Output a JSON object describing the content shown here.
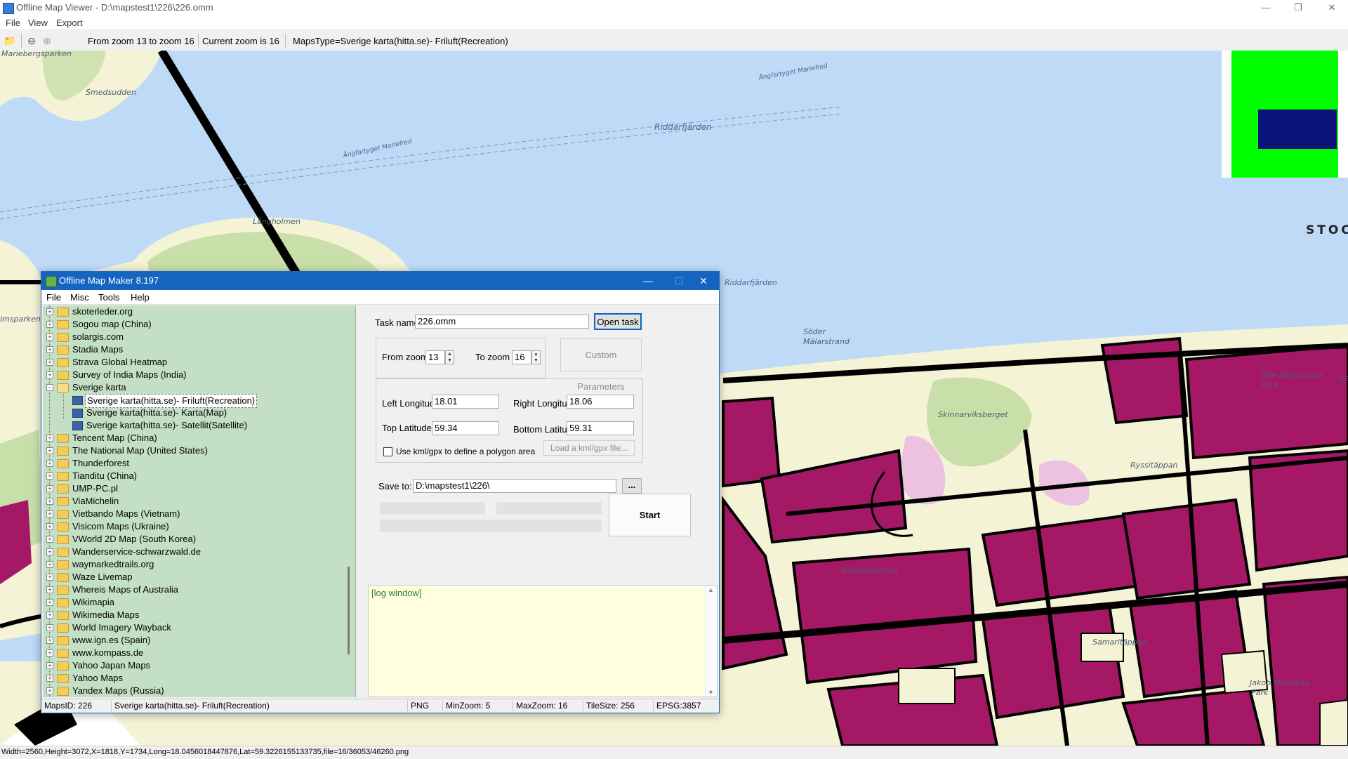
{
  "viewer": {
    "title": "Offline Map Viewer - D:\\mapstest1\\226\\226.omm",
    "menu": [
      "File",
      "View",
      "Export"
    ],
    "toolbar": {
      "zoom_range": "From zoom 13 to zoom 16",
      "current_zoom": "Current zoom is 16",
      "maps_type": "MapsType=Sverige karta(hitta.se)- Friluft(Recreation)"
    },
    "status": "Width=2560,Height=3072,X=1818,Y=1734,Long=18.0456018447876,Lat=59.3226155133735,file=16/36053/46260.png"
  },
  "map": {
    "labels": {
      "mariebergsparken": "Mariebergsparken",
      "smedsudden": "Smedsudden",
      "riddarfjarden": "Riddarfjärden",
      "riddarfjarden2": "Riddarfjärden",
      "angfartyget1": "Ångfartyget Mariefred",
      "angfartyget2": "Ångfartyget Mariefred",
      "langholmen": "Långholmen",
      "stockholm": "STOCK",
      "soder": "Söder",
      "malarstrand": "Mälarstrand",
      "olle": "Olle Adolphsons",
      "park": "Park",
      "iva": "Iva",
      "skinnarviksberget": "Skinnarviksberget",
      "rysstappan": "Ryssitäppan",
      "ansgarsparken": "Ansgarsparken",
      "samaritappan": "Samaritäppan",
      "jakob": "Jakob Mormnas",
      "park2": "Park",
      "imsparken": "imsparken"
    }
  },
  "dialog": {
    "title": "Offline Map Maker 8.197",
    "menu": [
      "File",
      "Misc",
      "Tools",
      "Help"
    ],
    "tree": {
      "items_before": [
        "skoterleder.org",
        "Sogou map (China)",
        "solargis.com",
        "Stadia Maps",
        "Strava Global Heatmap",
        "Survey of India Maps (India)"
      ],
      "expanded": "Sverige karta",
      "children": [
        "Sverige karta(hitta.se)- Friluft(Recreation)",
        "Sverige karta(hitta.se)- Karta(Map)",
        "Sverige karta(hitta.se)- Satellit(Satellite)"
      ],
      "items_after": [
        "Tencent Map (China)",
        "The National Map (United States)",
        "Thunderforest",
        "Tianditu (China)",
        "UMP-PC.pl",
        "ViaMichelin",
        "Vietbando Maps (Vietnam)",
        "Visicom Maps (Ukraine)",
        "VWorld 2D Map (South Korea)",
        "Wanderservice-schwarzwald.de",
        "waymarkedtrails.org",
        "Waze Livemap",
        "Whereis Maps of Australia",
        "Wikimapia",
        "Wikimedia Maps",
        "World Imagery Wayback",
        "www.ign.es (Spain)",
        "www.kompass.de",
        "Yahoo Japan Maps",
        "Yahoo Maps",
        "Yandex Maps (Russia)"
      ]
    },
    "form": {
      "task_name_label": "Task name",
      "task_name_value": "226.omm",
      "open_task": "Open task ...",
      "from_zoom_label": "From zoom",
      "from_zoom_value": "13",
      "to_zoom_label": "To zoom",
      "to_zoom_value": "16",
      "custom_params": "Custom Parameters",
      "left_lon_label": "Left Longitude",
      "left_lon_value": "18.01",
      "right_lon_label": "Right Longitude",
      "right_lon_value": "18.06",
      "top_lat_label": "Top Latitude",
      "top_lat_value": "59.34",
      "bottom_lat_label": "Bottom Latitude",
      "bottom_lat_value": "59.31",
      "kml_label": "Use kml/gpx to define a polygon area",
      "load_kml": "Load a kml/gpx file...",
      "save_to_label": "Save to:",
      "save_to_value": "D:\\mapstest1\\226\\",
      "browse": "...",
      "start": "Start"
    },
    "log": "[log window]",
    "status": {
      "maps_id": "MapsID: 226",
      "maps_name": "Sverige karta(hitta.se)- Friluft(Recreation)",
      "format": "PNG",
      "min_zoom": "MinZoom: 5",
      "max_zoom": "MaxZoom: 16",
      "tile_size": "TileSize: 256",
      "epsg": "EPSG:3857"
    }
  }
}
